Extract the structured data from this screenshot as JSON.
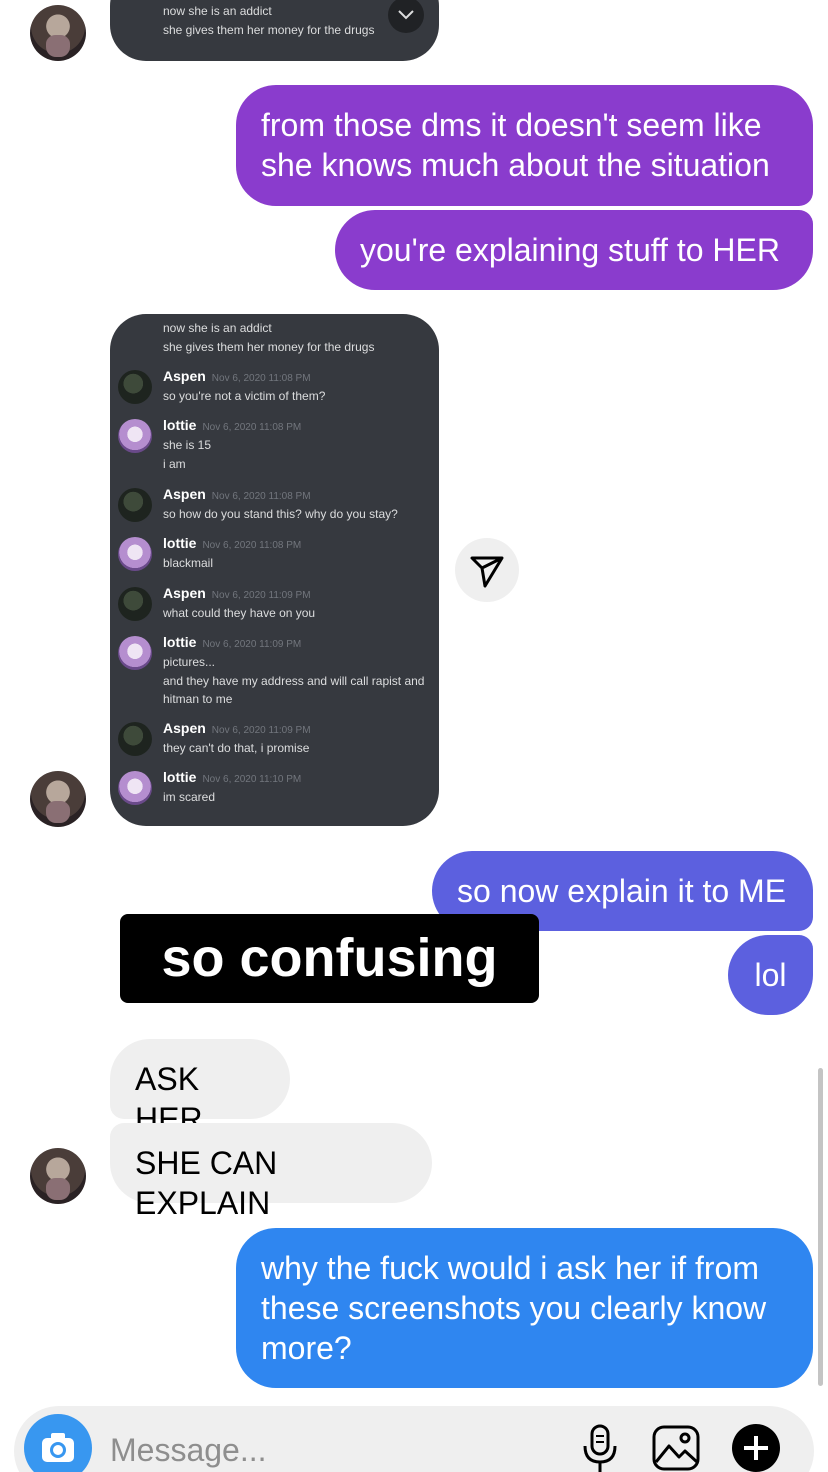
{
  "thread": {
    "top_screenshot": {
      "lines": [
        "now she is an addict",
        "she gives them her money for the drugs"
      ]
    },
    "sent_1": [
      "from those dms it doesn't seem like",
      "she knows much about the situation"
    ],
    "sent_2": "you're explaining stuff to HER",
    "screenshot": {
      "intro": [
        "now she is an addict",
        "she gives them her money for the drugs"
      ],
      "messages": [
        {
          "name": "Aspen",
          "time": "Nov 6, 2020 11:08 PM",
          "lines": [
            "so you're not a victim of them?"
          ]
        },
        {
          "name": "lottie",
          "time": "Nov 6, 2020 11:08 PM",
          "lines": [
            "she is 15",
            "i am"
          ]
        },
        {
          "name": "Aspen",
          "time": "Nov 6, 2020 11:08 PM",
          "lines": [
            "so how do you stand this? why do you stay?"
          ]
        },
        {
          "name": "lottie",
          "time": "Nov 6, 2020 11:08 PM",
          "lines": [
            "blackmail"
          ]
        },
        {
          "name": "Aspen",
          "time": "Nov 6, 2020 11:09 PM",
          "lines": [
            "what could they have on you"
          ]
        },
        {
          "name": "lottie",
          "time": "Nov 6, 2020 11:09 PM",
          "lines": [
            "pictures...",
            "and they have my address and will call rapist and",
            "hitman to me"
          ]
        },
        {
          "name": "Aspen",
          "time": "Nov 6, 2020 11:09 PM",
          "lines": [
            "they can't do that, i promise"
          ]
        },
        {
          "name": "lottie",
          "time": "Nov 6, 2020 11:10 PM",
          "lines": [
            "im scared"
          ]
        }
      ]
    },
    "sent_3": "so now explain it to ME",
    "sent_4": "lol",
    "caption": "so confusing",
    "received_1": "ASK HER",
    "received_2": "SHE CAN EXPLAIN",
    "sent_5": [
      "why the fuck would i ask her if from",
      "these screenshots you clearly know",
      "more?"
    ]
  },
  "composer": {
    "placeholder": "Message..."
  },
  "icons": [
    "camera-icon",
    "microphone-icon",
    "gallery-icon",
    "plus-icon",
    "send-icon",
    "chevron-down-icon"
  ],
  "colors": {
    "purple_bubble": "#8a3ccd",
    "indigo_bubble": "#5c60df",
    "blue_bubble": "#2f86f0",
    "gray_bubble": "#efefef",
    "discord_bg": "#36393f",
    "camera_button": "#3897f0"
  }
}
